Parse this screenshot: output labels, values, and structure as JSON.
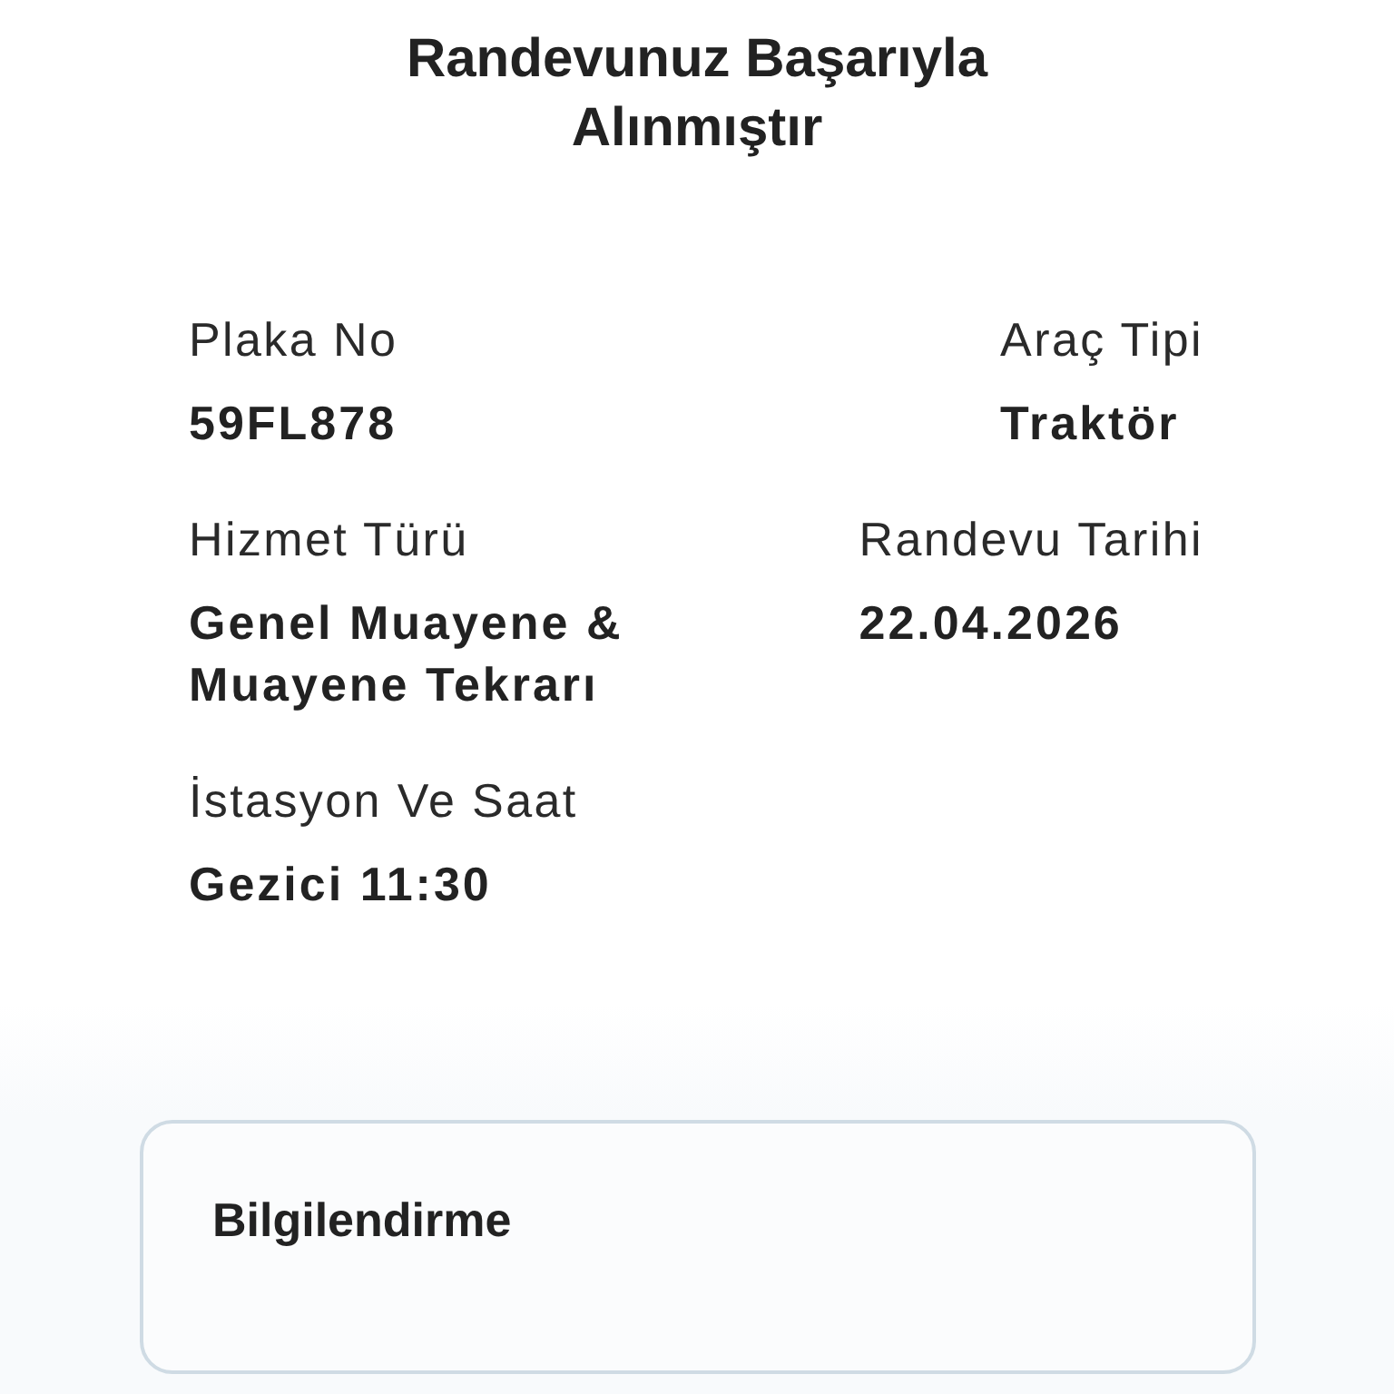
{
  "title": "Randevunuz Başarıyla Alınmıştır",
  "rows": [
    [
      {
        "label": "Plaka No",
        "value": "59FL878"
      },
      {
        "label": "Araç Tipi",
        "value": "Traktör"
      }
    ],
    [
      {
        "label": "Hizmet Türü",
        "value": "Genel Muayene & Muayene Tekrarı"
      },
      {
        "label": "Randevu Tarihi",
        "value": "22.04.2026"
      }
    ],
    [
      {
        "label": "İstasyon Ve Saat",
        "value": "Gezici 11:30"
      }
    ]
  ],
  "info_card": {
    "title": "Bilgilendirme"
  }
}
